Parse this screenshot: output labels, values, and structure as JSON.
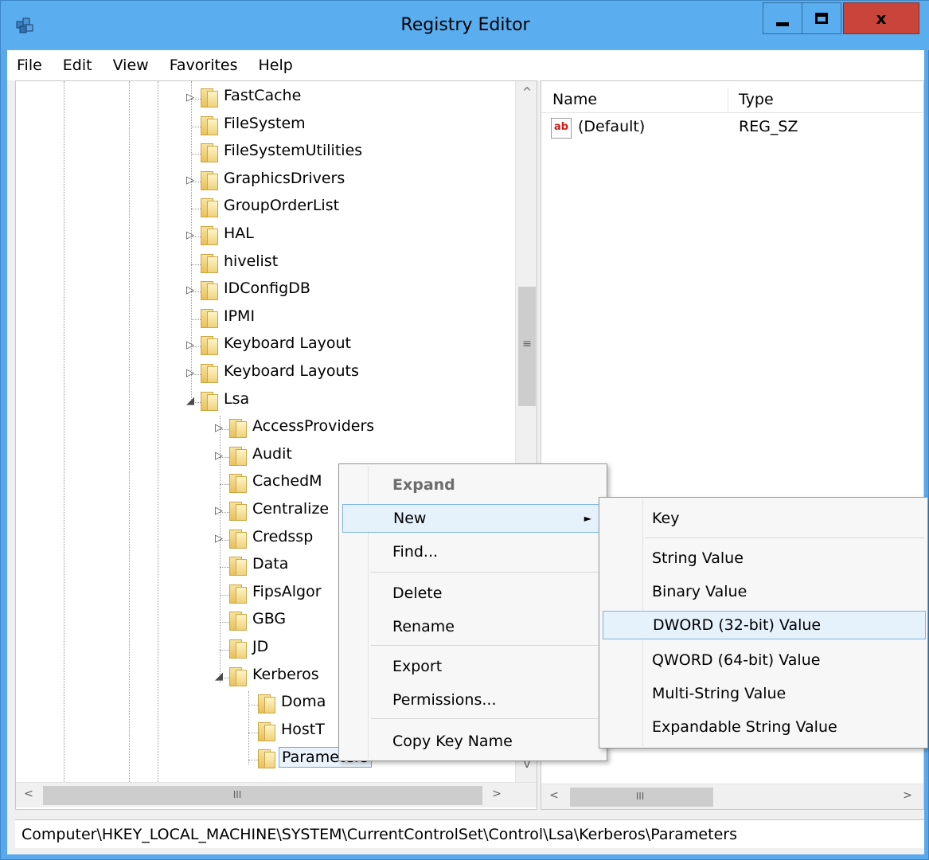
{
  "window": {
    "title": "Registry Editor",
    "close_glyph": "x"
  },
  "menubar": [
    "File",
    "Edit",
    "View",
    "Favorites",
    "Help"
  ],
  "tree": {
    "items": [
      {
        "label": "FastCache",
        "expander": "▷"
      },
      {
        "label": "FileSystem",
        "expander": ""
      },
      {
        "label": "FileSystemUtilities",
        "expander": ""
      },
      {
        "label": "GraphicsDrivers",
        "expander": "▷"
      },
      {
        "label": "GroupOrderList",
        "expander": ""
      },
      {
        "label": "HAL",
        "expander": "▷"
      },
      {
        "label": "hivelist",
        "expander": ""
      },
      {
        "label": "IDConfigDB",
        "expander": "▷"
      },
      {
        "label": "IPMI",
        "expander": ""
      },
      {
        "label": "Keyboard Layout",
        "expander": "▷"
      },
      {
        "label": "Keyboard Layouts",
        "expander": "▷"
      },
      {
        "label": "Lsa",
        "expander": "◢"
      },
      {
        "label": "AccessProviders",
        "expander": "▷"
      },
      {
        "label": "Audit",
        "expander": "▷"
      },
      {
        "label": "CachedM",
        "expander": ""
      },
      {
        "label": "Centralize",
        "expander": "▷"
      },
      {
        "label": "Credssp",
        "expander": "▷"
      },
      {
        "label": "Data",
        "expander": ""
      },
      {
        "label": "FipsAlgor",
        "expander": ""
      },
      {
        "label": "GBG",
        "expander": ""
      },
      {
        "label": "JD",
        "expander": ""
      },
      {
        "label": "Kerberos",
        "expander": "◢"
      },
      {
        "label": "Doma",
        "expander": ""
      },
      {
        "label": "HostT",
        "expander": ""
      },
      {
        "label": "Parameters",
        "expander": ""
      }
    ]
  },
  "scroll": {
    "up": "^",
    "down": "v",
    "left": "<",
    "right": ">",
    "grip": "≡",
    "hgrip": "III"
  },
  "values": {
    "columns": [
      "Name",
      "Type"
    ],
    "rows": [
      {
        "icon": "ab",
        "name": "(Default)",
        "type": "REG_SZ"
      }
    ]
  },
  "context_menu": {
    "items": [
      "Expand",
      "New",
      "Find...",
      "Delete",
      "Rename",
      "Export",
      "Permissions...",
      "Copy Key Name"
    ],
    "arrow": "►"
  },
  "sub_menu": {
    "items": [
      "Key",
      "String Value",
      "Binary Value",
      "DWORD (32-bit) Value",
      "QWORD (64-bit) Value",
      "Multi-String Value",
      "Expandable String Value"
    ]
  },
  "statusbar": {
    "path": "Computer\\HKEY_LOCAL_MACHINE\\SYSTEM\\CurrentControlSet\\Control\\Lsa\\Kerberos\\Parameters"
  }
}
